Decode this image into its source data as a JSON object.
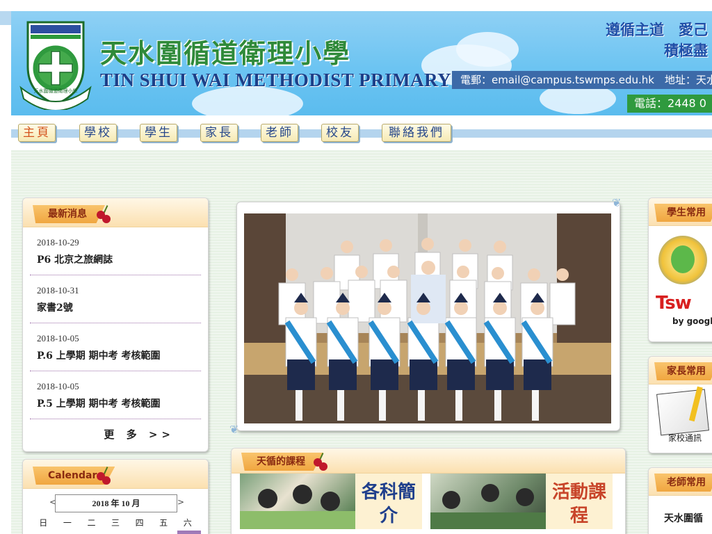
{
  "header": {
    "school_name_cn": "天水圍循道衛理小學",
    "school_name_en": "TIN SHUI WAI METHODIST PRIMARY SCHOOL",
    "crest_text": "天水圍循道衛理小學",
    "motto_line1": "遵循主道　愛己",
    "motto_line2": "積極盡",
    "email_text": "電郵：email@campus.tswmps.edu.hk　地址：天水",
    "phone_text": "電話：2448 0"
  },
  "nav": {
    "items": [
      {
        "label": "主頁"
      },
      {
        "label": "學校"
      },
      {
        "label": "學生"
      },
      {
        "label": "家長"
      },
      {
        "label": "老師"
      },
      {
        "label": "校友"
      },
      {
        "label": "聯絡我們"
      }
    ]
  },
  "news": {
    "title": "最新消息",
    "items": [
      {
        "date": "2018-10-29",
        "title": "P6 北京之旅網誌"
      },
      {
        "date": "2018-10-31",
        "title": "家書2號"
      },
      {
        "date": "2018-10-05",
        "title": "P.6 上學期 期中考 考核範圍"
      },
      {
        "date": "2018-10-05",
        "title": "P.5 上學期 期中考 考核範圍"
      }
    ],
    "more_label": "更 多 >>"
  },
  "calendar": {
    "title": "Calendar",
    "month_label": "2018 年 10 月",
    "prev_label": "<",
    "next_label": ">",
    "weekdays": [
      "日",
      "一",
      "二",
      "三",
      "四",
      "五",
      "六"
    ]
  },
  "courses": {
    "title": "天循的課程",
    "items": [
      {
        "label": "各科簡介"
      },
      {
        "label": "活動課程"
      }
    ]
  },
  "right_panels": {
    "student": {
      "title": "學生常用"
    },
    "student_link2": "Tsw",
    "student_link2_sub": "by googl",
    "parent": {
      "title": "家長常用"
    },
    "parent_link": "家校通訊",
    "teacher": {
      "title": "老師常用"
    },
    "teacher_link": "天水圍循"
  },
  "colors": {
    "banner": "#6cc4f2",
    "nav_text": "#26478a",
    "nav_active": "#d4541e",
    "panel_tag": "#f0a640"
  }
}
